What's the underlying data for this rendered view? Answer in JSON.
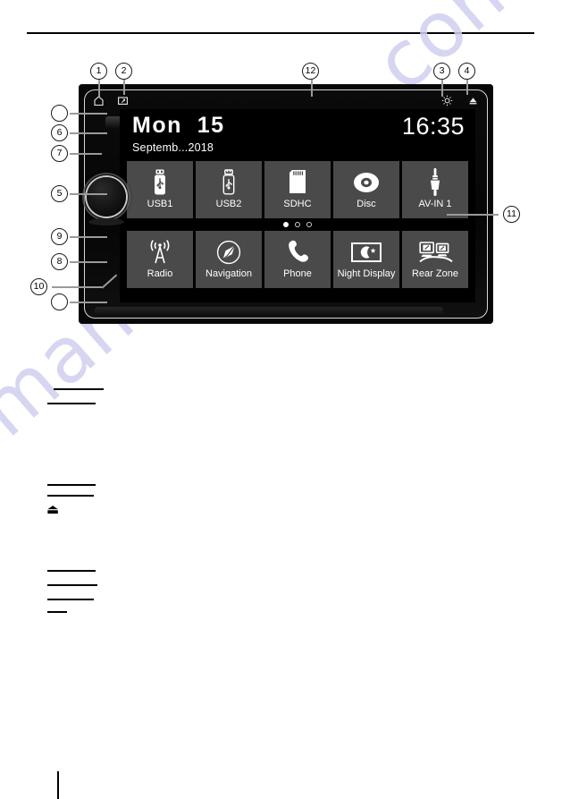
{
  "document": {
    "watermark": "manualshive.com"
  },
  "device": {
    "status_bar": {
      "left_icons": [
        {
          "name": "home-icon",
          "label": "Home"
        },
        {
          "name": "screen-capture-icon",
          "label": "Screen"
        }
      ],
      "right_icons": [
        {
          "name": "brightness-icon",
          "label": "Brightness"
        },
        {
          "name": "eject-icon",
          "label": "Eject"
        }
      ]
    },
    "screen": {
      "date_main": "Mon  15",
      "date_sub": "Septemb...2018",
      "time": "16:35",
      "tiles_row1": [
        {
          "label": "USB1",
          "icon": "usb-icon"
        },
        {
          "label": "USB2",
          "icon": "usb-icon"
        },
        {
          "label": "SDHC",
          "icon": "sd-card-icon"
        },
        {
          "label": "Disc",
          "icon": "disc-icon"
        },
        {
          "label": "AV-IN 1",
          "icon": "av-jack-icon"
        }
      ],
      "tiles_row2": [
        {
          "label": "Radio",
          "icon": "radio-tower-icon"
        },
        {
          "label": "Navigation",
          "icon": "compass-icon"
        },
        {
          "label": "Phone",
          "icon": "phone-icon"
        },
        {
          "label": "Night Display",
          "icon": "night-moon-icon"
        },
        {
          "label": "Rear Zone",
          "icon": "rear-zone-icon"
        }
      ],
      "page_dots": {
        "count": 3,
        "active_index": 0
      }
    },
    "knob": {
      "name": "volume-knob"
    }
  },
  "callouts": [
    {
      "id": "c1",
      "label": "1"
    },
    {
      "id": "c2",
      "label": "2"
    },
    {
      "id": "c12",
      "label": "12"
    },
    {
      "id": "c3",
      "label": "3"
    },
    {
      "id": "c4",
      "label": "4"
    },
    {
      "id": "cTop",
      "label": ""
    },
    {
      "id": "c6",
      "label": "6"
    },
    {
      "id": "c7",
      "label": "7"
    },
    {
      "id": "c5",
      "label": "5"
    },
    {
      "id": "c9",
      "label": "9"
    },
    {
      "id": "c8",
      "label": "8"
    },
    {
      "id": "c10",
      "label": "10"
    },
    {
      "id": "cBot",
      "label": ""
    },
    {
      "id": "c11",
      "label": "11"
    }
  ],
  "body_text": {
    "eject_glyph": "⏏"
  }
}
